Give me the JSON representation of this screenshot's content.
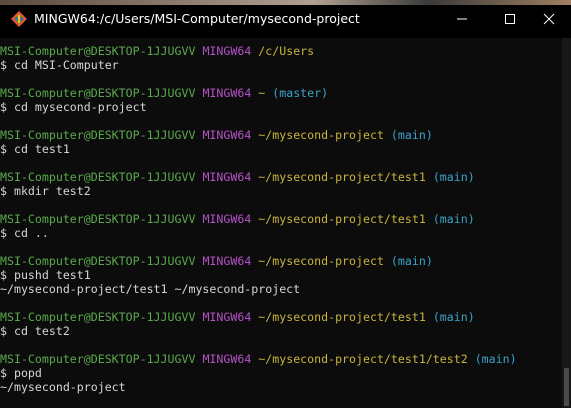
{
  "window": {
    "title": "MINGW64:/c/Users/MSI-Computer/mysecond-project"
  },
  "colors": {
    "user_host": "#5ba94e",
    "msystem": "#b552c8",
    "path": "#c8b43e",
    "branch": "#3aa3c9",
    "text": "#d6d6d6"
  },
  "icons": {
    "app": "git-bash-diamond-icon",
    "minimize": "minimize-icon",
    "maximize": "maximize-icon",
    "close": "close-icon"
  },
  "terminal": {
    "blocks": [
      {
        "user": "MSI-Computer@DESKTOP-1JJUGVV",
        "msys": "MINGW64",
        "path": "/c/Users",
        "branch": "",
        "command": "$ cd MSI-Computer",
        "output": []
      },
      {
        "user": "MSI-Computer@DESKTOP-1JJUGVV",
        "msys": "MINGW64",
        "path": "~",
        "branch": "(master)",
        "command": "$ cd mysecond-project",
        "output": []
      },
      {
        "user": "MSI-Computer@DESKTOP-1JJUGVV",
        "msys": "MINGW64",
        "path": "~/mysecond-project",
        "branch": "(main)",
        "command": "$ cd test1",
        "output": []
      },
      {
        "user": "MSI-Computer@DESKTOP-1JJUGVV",
        "msys": "MINGW64",
        "path": "~/mysecond-project/test1",
        "branch": "(main)",
        "command": "$ mkdir test2",
        "output": []
      },
      {
        "user": "MSI-Computer@DESKTOP-1JJUGVV",
        "msys": "MINGW64",
        "path": "~/mysecond-project/test1",
        "branch": "(main)",
        "command": "$ cd ..",
        "output": []
      },
      {
        "user": "MSI-Computer@DESKTOP-1JJUGVV",
        "msys": "MINGW64",
        "path": "~/mysecond-project",
        "branch": "(main)",
        "command": "$ pushd test1",
        "output": [
          "~/mysecond-project/test1 ~/mysecond-project"
        ]
      },
      {
        "user": "MSI-Computer@DESKTOP-1JJUGVV",
        "msys": "MINGW64",
        "path": "~/mysecond-project/test1",
        "branch": "(main)",
        "command": "$ cd test2",
        "output": []
      },
      {
        "user": "MSI-Computer@DESKTOP-1JJUGVV",
        "msys": "MINGW64",
        "path": "~/mysecond-project/test1/test2",
        "branch": "(main)",
        "command": "$ popd",
        "output": [
          "~/mysecond-project"
        ]
      }
    ]
  }
}
